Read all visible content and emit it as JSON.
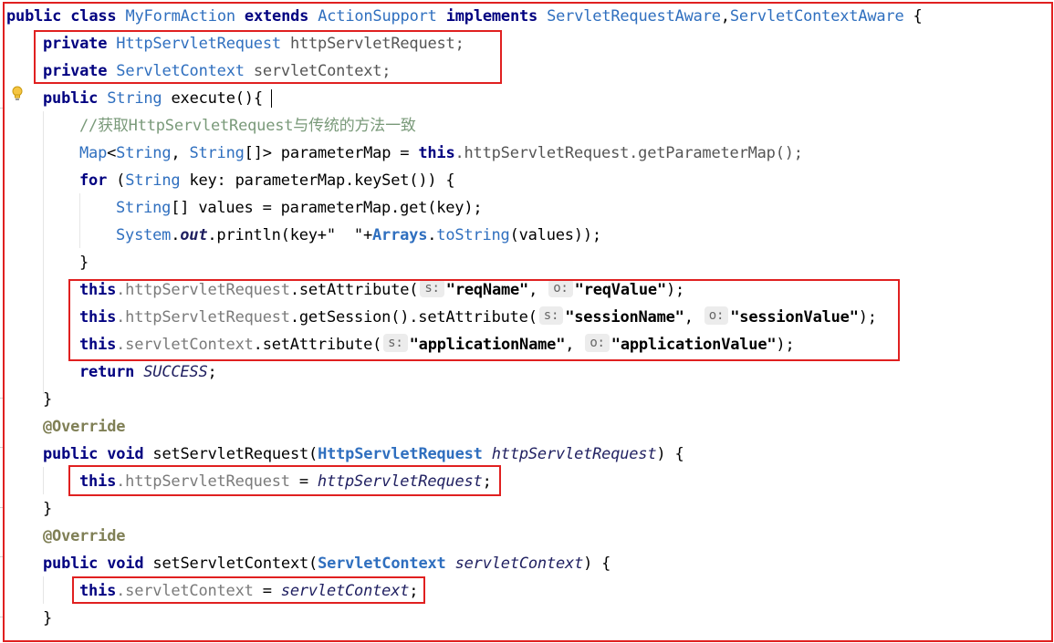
{
  "code": {
    "l1": {
      "kw1": "public class ",
      "cls1": "MyFormAction",
      "kw2": " extends ",
      "cls2": "ActionSupport",
      "kw3": " implements ",
      "cls3": "ServletRequestAware",
      "comma": ",",
      "cls4": "ServletContextAware",
      "brace": " {"
    },
    "l2": {
      "kw": "private ",
      "type": "HttpServletRequest",
      "name": " httpServletRequest;"
    },
    "l3": {
      "kw": "private ",
      "type": "ServletContext",
      "name": " servletContext;"
    },
    "l4": {
      "kw": "public ",
      "type": "String",
      "name": " execute()",
      "brace": "{"
    },
    "l5": {
      "comment": "//获取HttpServletRequest与传统的方法一致"
    },
    "l6": {
      "t1": "Map",
      "p1": "<",
      "t2": "String",
      "p2": ", ",
      "t3": "String",
      "p3": "[]> parameterMap = ",
      "kw": "this",
      "rest": ".httpServletRequest.getParameterMap();"
    },
    "l7": {
      "kw": "for ",
      "p1": "(",
      "t1": "String",
      "rest": " key: parameterMap.keySet()) {"
    },
    "l8": {
      "t1": "String",
      "rest": "[] values = parameterMap.get(key);"
    },
    "l9": {
      "t1": "System",
      "p1": ".",
      "it": "out",
      "p2": ".println(key+\"  \"+",
      "t2": "Arrays",
      "p3": ".",
      "m": "toString",
      "p4": "(values));"
    },
    "l10": {
      "brace": "}"
    },
    "l11": {
      "kw": "this",
      "fld": ".httpServletRequest",
      "m": ".setAttribute(",
      "h1": "s:",
      "s1": "\"reqName\"",
      "c": ", ",
      "h2": "o:",
      "s2": "\"reqValue\"",
      "end": ");"
    },
    "l12": {
      "kw": "this",
      "fld": ".httpServletRequest",
      "m": ".getSession().setAttribute(",
      "h1": "s:",
      "s1": "\"sessionName\"",
      "c": ", ",
      "h2": "o:",
      "s2": "\"sessionValue\"",
      "end": ");"
    },
    "l13": {
      "kw": "this",
      "fld": ".servletContext",
      "m": ".setAttribute(",
      "h1": "s:",
      "s1": "\"applicationName\"",
      "c": ", ",
      "h2": "o:",
      "s2": "\"applicationValue\"",
      "end": ");"
    },
    "l14": {
      "kw": "return ",
      "it": "SUCCESS",
      "end": ";"
    },
    "l15": {
      "brace": "}"
    },
    "l16": {
      "ann": "@Override"
    },
    "l17": {
      "kw": "public void ",
      "m": "setServletRequest(",
      "type": "HttpServletRequest",
      "sp": " ",
      "it": "httpServletRequest",
      "end": ") {"
    },
    "l18": {
      "kw": "this",
      "fld": ".httpServletRequest",
      "eq": " = ",
      "it": "httpServletRequest",
      "end": ";"
    },
    "l19": {
      "brace": "}"
    },
    "l20": {
      "ann": "@Override"
    },
    "l21": {
      "kw": "public void ",
      "m": "setServletContext(",
      "type": "ServletContext",
      "sp": " ",
      "it": "servletContext",
      "end": ") {"
    },
    "l22": {
      "kw": "this",
      "fld": ".servletContext",
      "eq": " = ",
      "it": "servletContext",
      "end": ";"
    },
    "l23": {
      "brace": "}"
    }
  },
  "colors": {
    "highlight_box": "#e02020",
    "keyword": "#000080",
    "type": "#2f6fbf"
  },
  "icons": {
    "gutter": "lightbulb-icon"
  }
}
